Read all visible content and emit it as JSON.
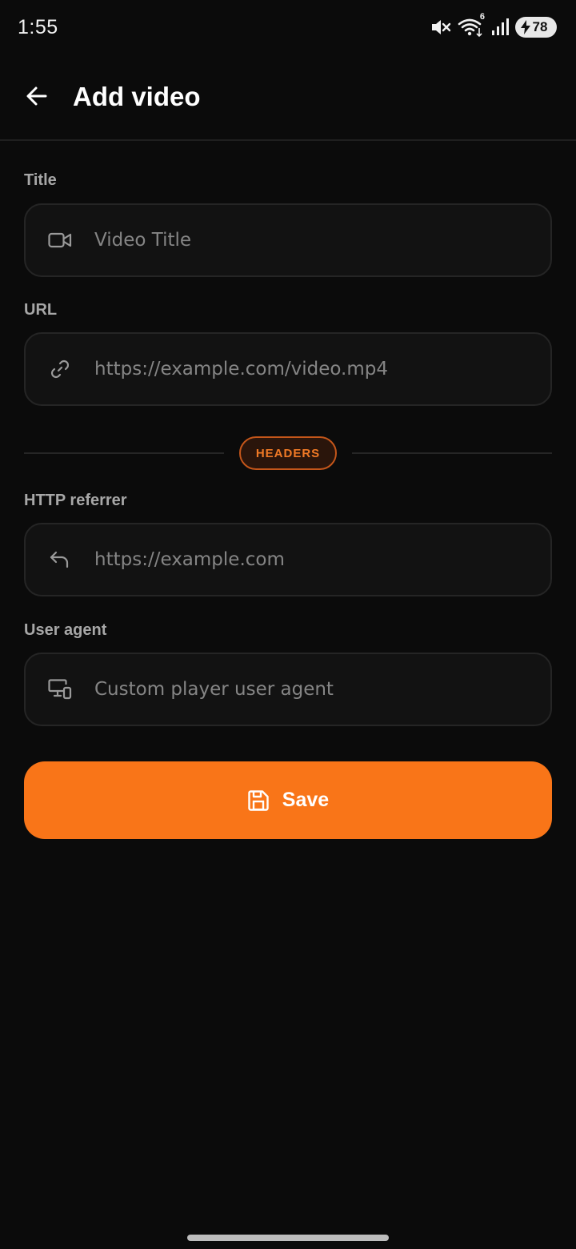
{
  "status_bar": {
    "time": "1:55",
    "network_badge": "6",
    "battery_level": "78",
    "icons": [
      "mute-icon",
      "wifi-icon",
      "signal-icon",
      "battery-icon"
    ]
  },
  "app_bar": {
    "title": "Add video",
    "back_icon": "arrow-left-icon"
  },
  "form": {
    "title": {
      "label": "Title",
      "placeholder": "Video Title",
      "value": "",
      "icon": "video-camera-icon"
    },
    "url": {
      "label": "URL",
      "placeholder": "https://example.com/video.mp4",
      "value": "",
      "icon": "link-icon"
    },
    "section_chip": "HEADERS",
    "referrer": {
      "label": "HTTP referrer",
      "placeholder": "https://example.com",
      "value": "",
      "icon": "reply-arrow-icon"
    },
    "user_agent": {
      "label": "User agent",
      "placeholder": "Custom player user agent",
      "value": "",
      "icon": "devices-icon"
    }
  },
  "save_button": {
    "label": "Save",
    "icon": "floppy-disk-icon"
  },
  "colors": {
    "background": "#0b0b0b",
    "accent": "#f97518",
    "field_bg": "#121212",
    "field_border": "#252525",
    "label": "#a7a7a7",
    "placeholder": "#858585"
  }
}
